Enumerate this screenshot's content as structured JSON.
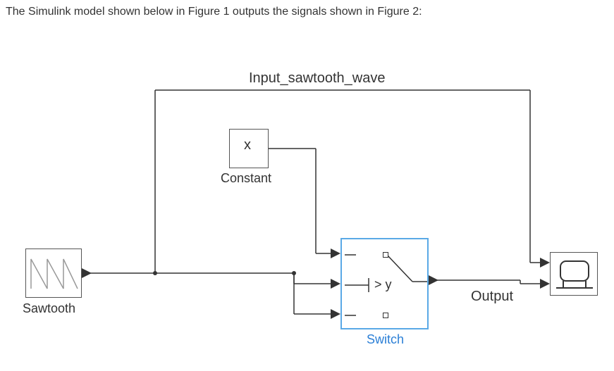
{
  "intro": "The Simulink model shown below in Figure 1 outputs the signals shown in Figure 2:",
  "signals": {
    "top_signal": "Input_sawtooth_wave",
    "output_signal": "Output"
  },
  "blocks": {
    "sawtooth": {
      "label": "Sawtooth"
    },
    "constant": {
      "value": "x",
      "label": "Constant"
    },
    "switch": {
      "condition": "> y",
      "label": "Switch"
    },
    "scope": {
      "label": ""
    }
  },
  "colors": {
    "line": "#333333",
    "selected": "#5aa9e6",
    "link": "#2b7fd6"
  }
}
